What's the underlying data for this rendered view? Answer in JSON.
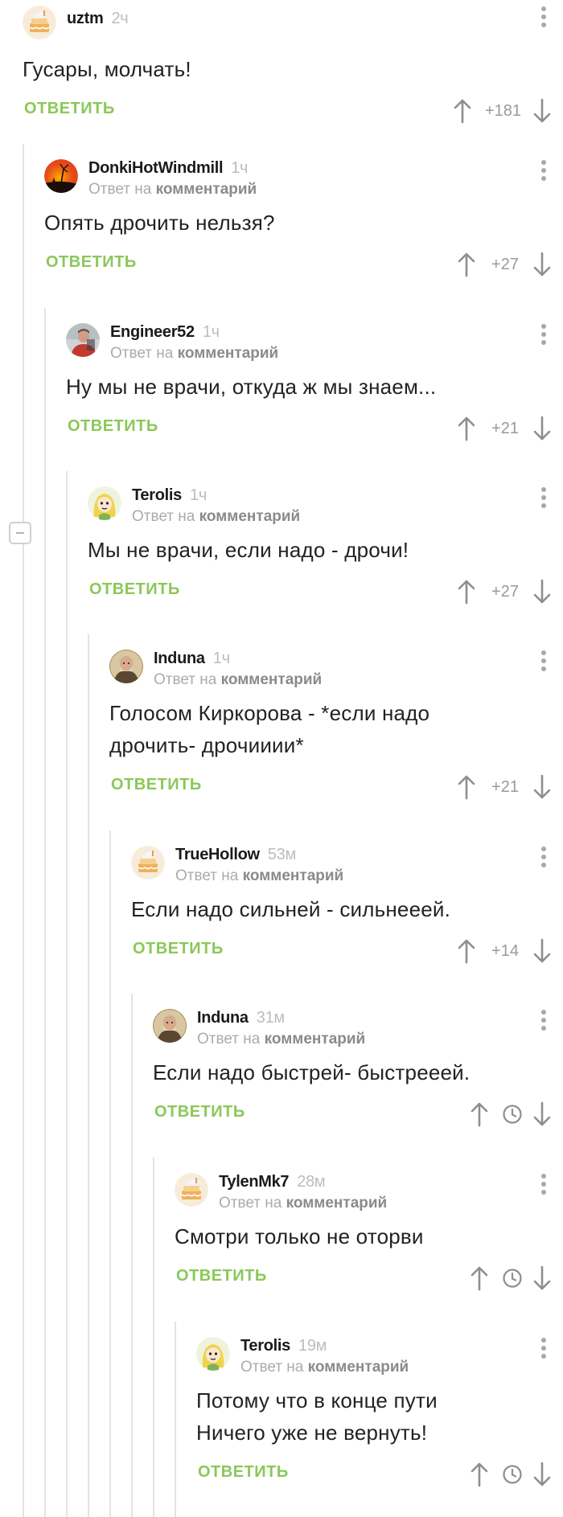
{
  "labels": {
    "reply_prefix": "Ответ на",
    "reply_link": "комментарий",
    "reply_button": "ОТВЕТИТЬ"
  },
  "comments": [
    {
      "author": "uztm",
      "time": "2ч",
      "text": "Гусары, молчать!",
      "rating": "+181",
      "avatar": "cake-icon",
      "is_reply": false
    },
    {
      "author": "DonkiHotWindmill",
      "time": "1ч",
      "text": "Опять дрочить нельзя?",
      "rating": "+27",
      "avatar": "sunset-windmill-icon",
      "is_reply": true
    },
    {
      "author": "Engineer52",
      "time": "1ч",
      "text": "Ну мы не врачи, откуда ж мы знаем...",
      "rating": "+21",
      "avatar": "photo-avatar-icon",
      "is_reply": true
    },
    {
      "author": "Terolis",
      "time": "1ч",
      "text": "Мы не врачи, если надо - дрочи!",
      "rating": "+27",
      "avatar": "cartoon-girl-icon",
      "is_reply": true
    },
    {
      "author": "Induna",
      "time": "1ч",
      "text": "Голосом Киркорова - *если надо дрочить- дрочииии*",
      "rating": "+21",
      "avatar": "elder-portrait-icon",
      "is_reply": true
    },
    {
      "author": "TrueHollow",
      "time": "53м",
      "text": "Если надо сильней - сильнееей.",
      "rating": "+14",
      "avatar": "cake-icon",
      "is_reply": true
    },
    {
      "author": "Induna",
      "time": "31м",
      "text": "Если надо быстрей- быстрееей.",
      "rating": null,
      "avatar": "elder-portrait-icon",
      "is_reply": true
    },
    {
      "author": "TylenMk7",
      "time": "28м",
      "text": "Смотри только не оторви",
      "rating": null,
      "avatar": "cake-icon",
      "is_reply": true
    },
    {
      "author": "Terolis",
      "time": "19м",
      "text": "Потому что в конце пути Ничего уже не вернуть!",
      "rating": null,
      "avatar": "cartoon-girl-icon",
      "is_reply": true
    }
  ],
  "colors": {
    "accent_green": "#8ac858",
    "muted_text": "#ababab",
    "thread_line": "#e3e3e3"
  }
}
